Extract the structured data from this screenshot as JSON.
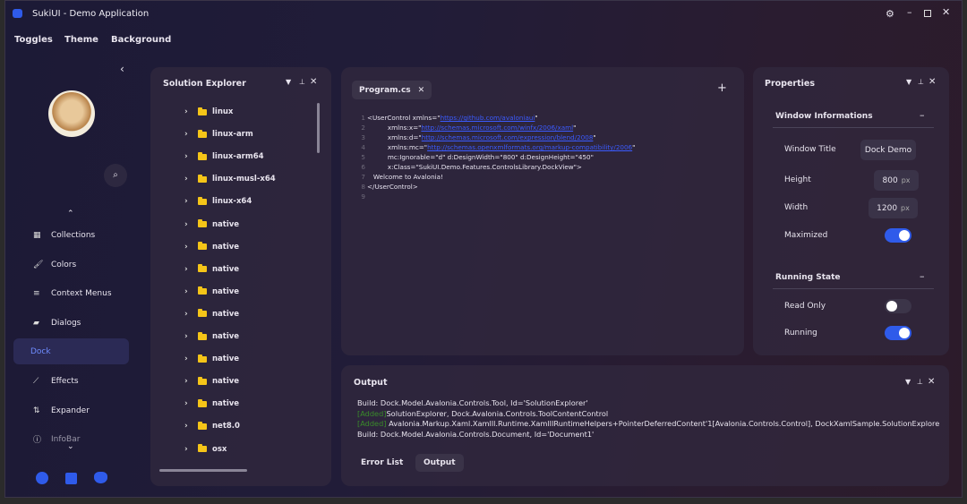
{
  "window": {
    "title": "SukiUI - Demo Application",
    "controls": [
      "settings",
      "minimize",
      "maximize",
      "close"
    ]
  },
  "menu": [
    "Toggles",
    "Theme",
    "Background"
  ],
  "sidebar": {
    "items": [
      {
        "label": "Collections",
        "icon": "collections-icon"
      },
      {
        "label": "Colors",
        "icon": "brush-icon"
      },
      {
        "label": "Context Menus",
        "icon": "menu-icon"
      },
      {
        "label": "Dialogs",
        "icon": "dialog-icon"
      },
      {
        "label": "Dock",
        "icon": "",
        "selected": true
      },
      {
        "label": "Effects",
        "icon": "wand-icon"
      },
      {
        "label": "Expander",
        "icon": "expander-icon"
      },
      {
        "label": "InfoBar",
        "icon": "info-icon"
      }
    ],
    "footer_icons": [
      "github-icon",
      "window-icon",
      "cat-icon"
    ]
  },
  "solution_explorer": {
    "title": "Solution Explorer",
    "items": [
      "linux",
      "linux-arm",
      "linux-arm64",
      "linux-musl-x64",
      "linux-x64",
      "native",
      "native",
      "native",
      "native",
      "native",
      "native",
      "native",
      "native",
      "native",
      "net8.0",
      "osx"
    ]
  },
  "document": {
    "tab": "Program.cs",
    "lines": [
      [
        "<UserControl xmlns=\"",
        "https://github.com/avaloniaui",
        "\""
      ],
      [
        "          xmlns:x=\"",
        "http://schemas.microsoft.com/winfx/2006/xaml",
        "\""
      ],
      [
        "          xmlns:d=\"",
        "http://schemas.microsoft.com/expression/blend/2008",
        "\""
      ],
      [
        "          xmlns:mc=\"",
        "http://schemas.openxmlformats.org/markup-compatibility/2006",
        "\""
      ],
      [
        "          mc:Ignorable=\"d\" d:DesignWidth=\"800\" d:DesignHeight=\"450\"",
        "",
        ""
      ],
      [
        "          x:Class=\"SukiUI.Demo.Features.ControlsLibrary.DockView\">",
        "",
        ""
      ],
      [
        "   Welcome to Avalonia!",
        "",
        ""
      ],
      [
        "</UserControl>",
        "",
        ""
      ],
      [
        "",
        "",
        ""
      ]
    ]
  },
  "properties": {
    "title": "Properties",
    "window_info": {
      "header": "Window Informations",
      "title_label": "Window Title",
      "title_value": "Dock Demo",
      "height_label": "Height",
      "height_value": "800",
      "width_label": "Width",
      "width_value": "1200",
      "unit": "px",
      "maximized_label": "Maximized",
      "maximized": true
    },
    "running_state": {
      "header": "Running State",
      "read_only_label": "Read Only",
      "read_only": false,
      "running_label": "Running",
      "running": true
    }
  },
  "output": {
    "title": "Output",
    "lines": [
      {
        "tag": "",
        "text": "Build: Dock.Model.Avalonia.Controls.Tool, Id='SolutionExplorer'"
      },
      {
        "tag": "[Added]",
        "text": "SolutionExplorer, Dock.Avalonia.Controls.ToolContentControl"
      },
      {
        "tag": "[Added]",
        "text": " Avalonia.Markup.Xaml.XamlIl.Runtime.XamlIlRuntimeHelpers+PointerDeferredContent'1[Avalonia.Controls.Control], DockXamlSample.SolutionExplore"
      },
      {
        "tag": "",
        "text": "Build: Dock.Model.Avalonia.Controls.Document, Id='Document1'"
      }
    ],
    "tabs": [
      "Error List",
      "Output"
    ]
  },
  "colors": {
    "accent": "#2f5bea",
    "folder": "#f5c518"
  }
}
